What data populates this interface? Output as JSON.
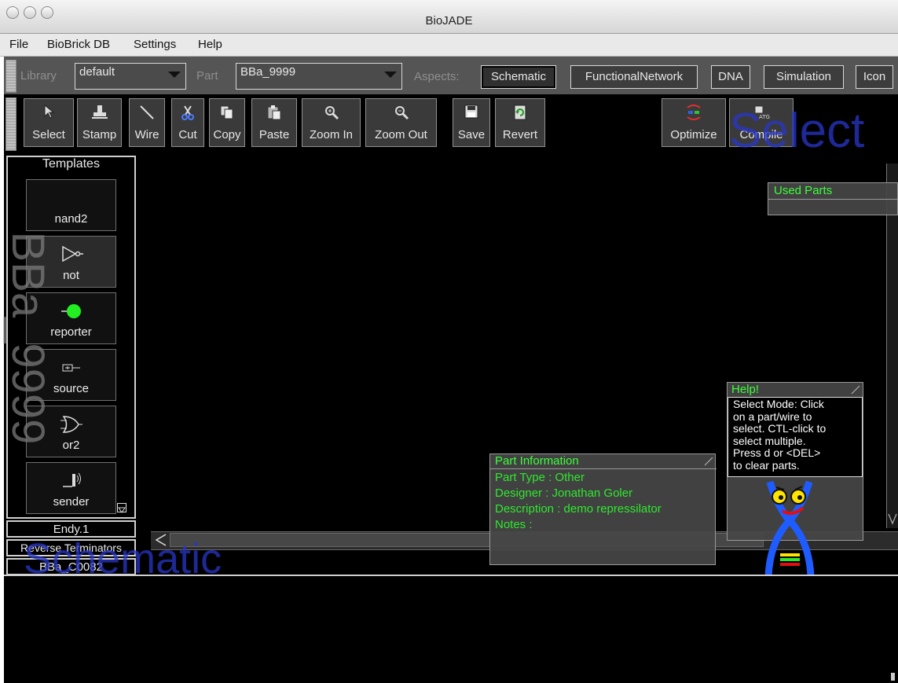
{
  "window": {
    "title": "BioJADE"
  },
  "menubar": {
    "items": [
      "File",
      "BioBrick DB",
      "Settings",
      "Help"
    ]
  },
  "aspects_bar": {
    "library_label": "Library",
    "library_value": "default",
    "part_label": "Part",
    "part_value": "BBa_9999",
    "aspects_label": "Aspects:",
    "aspects": [
      "Schematic",
      "FunctionalNetwork",
      "DNA",
      "Simulation",
      "Icon"
    ],
    "active_aspect": "Schematic"
  },
  "toolbar": {
    "tools": [
      {
        "label": "Select",
        "icon": "pointer-icon"
      },
      {
        "label": "Stamp",
        "icon": "stamp-icon"
      },
      {
        "label": "Wire",
        "icon": "wire-icon"
      },
      {
        "label": "Cut",
        "icon": "scissors-icon"
      },
      {
        "label": "Copy",
        "icon": "copy-icon"
      },
      {
        "label": "Paste",
        "icon": "paste-icon"
      },
      {
        "label": "Zoom In",
        "icon": "zoom-in-icon"
      },
      {
        "label": "Zoom Out",
        "icon": "zoom-out-icon"
      },
      {
        "label": "Save",
        "icon": "floppy-disk-icon"
      },
      {
        "label": "Revert",
        "icon": "revert-icon"
      },
      {
        "label": "Optimize",
        "icon": "optimize-icon"
      },
      {
        "label": "Compile",
        "icon": "compile-icon"
      }
    ]
  },
  "templates": {
    "title": "Templates",
    "items": [
      {
        "label": "nand2",
        "icon": "nand-gate-icon"
      },
      {
        "label": "not",
        "icon": "not-gate-icon"
      },
      {
        "label": "reporter",
        "icon": "reporter-dot-icon"
      },
      {
        "label": "source",
        "icon": "source-icon"
      },
      {
        "label": "or2",
        "icon": "or-gate-icon"
      },
      {
        "label": "sender",
        "icon": "sender-icon"
      }
    ],
    "selected": "not"
  },
  "lower_left": {
    "designer_tag": "Endy.1",
    "terminators_label": "Reverse Terminators",
    "terminator_part": "BBa_C0082"
  },
  "used_parts": {
    "title": "Used Parts"
  },
  "help": {
    "title": "Help!",
    "lines": [
      "Select Mode: Click",
      "on a part/wire to",
      "select. CTL-click to",
      "select multiple.",
      "Press d or <DEL>",
      "to clear parts."
    ]
  },
  "part_info": {
    "title": "Part Information",
    "part_type": "Part Type : Other",
    "designer": "Designer : Jonathan Goler",
    "description": "Description : demo repressilator",
    "notes": "Notes :"
  },
  "watermarks": {
    "mode": "Select",
    "view": "Schematic",
    "part_id": "BBa_9999"
  },
  "colors": {
    "background": "#000000",
    "panel_gray": "#555555",
    "accent_green": "#2ee82e",
    "reporter_green": "#22ee22",
    "watermark_blue": "#2836c8"
  }
}
